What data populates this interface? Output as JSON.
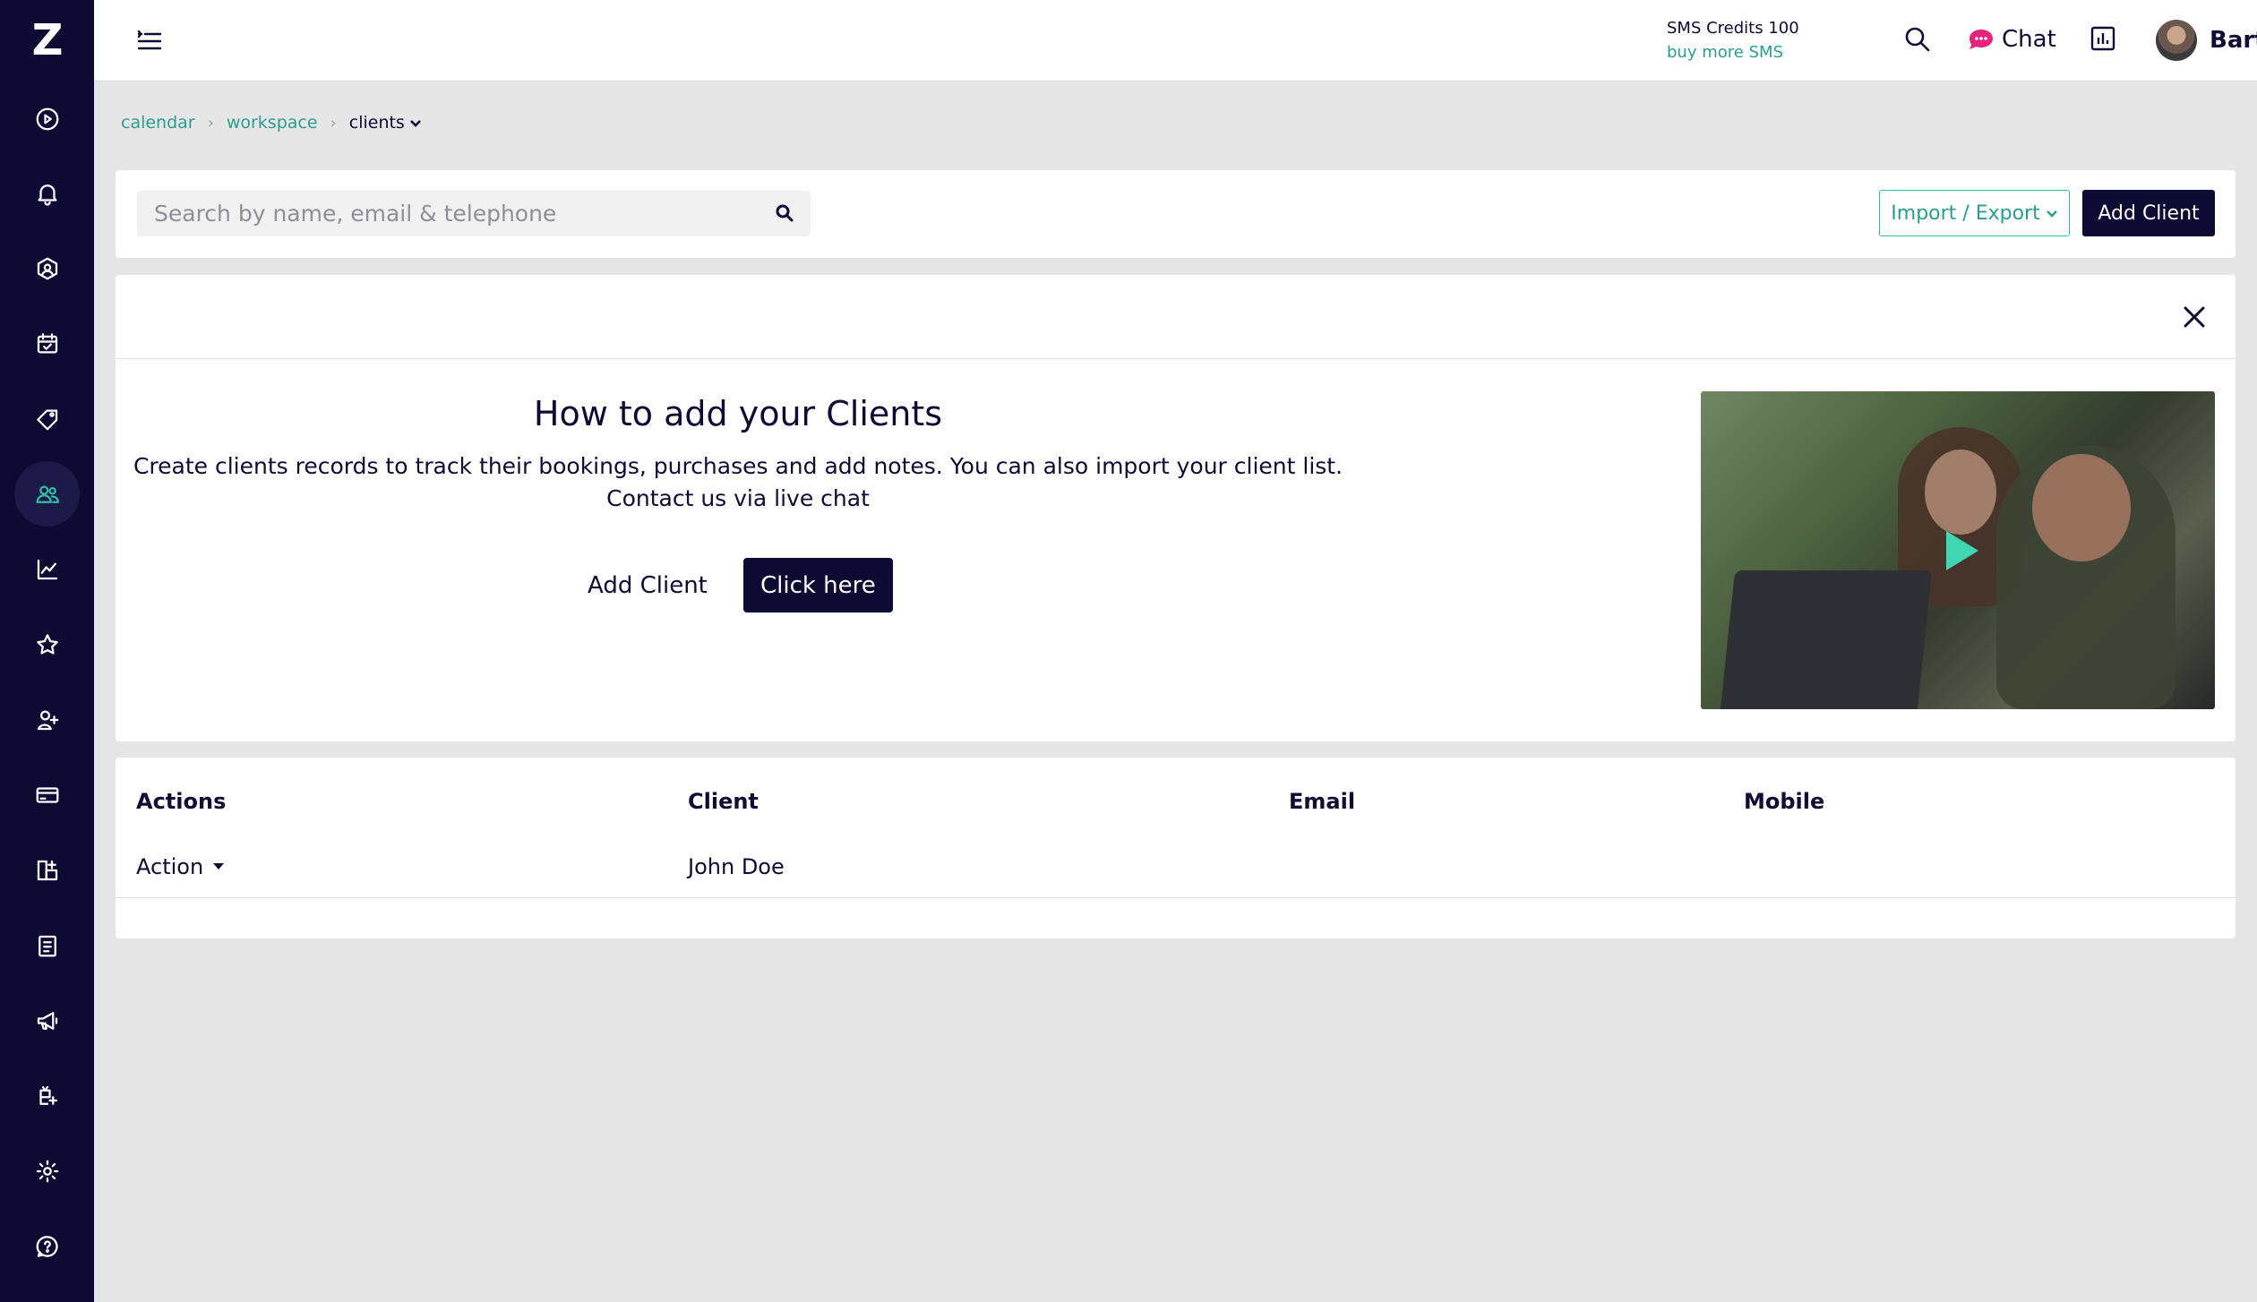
{
  "sidebar": {
    "logo": "Z",
    "items": [
      {
        "name": "play-circle-icon"
      },
      {
        "name": "bell-icon"
      },
      {
        "name": "cube-icon"
      },
      {
        "name": "calendar-check-icon"
      },
      {
        "name": "tag-icon"
      },
      {
        "name": "users-icon",
        "active": true
      },
      {
        "name": "chart-line-icon"
      },
      {
        "name": "star-icon"
      },
      {
        "name": "user-plus-icon"
      },
      {
        "name": "credit-card-icon"
      },
      {
        "name": "apps-add-icon"
      },
      {
        "name": "clipboard-icon"
      },
      {
        "name": "megaphone-icon"
      },
      {
        "name": "gift-icon"
      },
      {
        "name": "gear-icon"
      },
      {
        "name": "help-icon"
      }
    ]
  },
  "topbar": {
    "sms_credits": "SMS Credits 100",
    "buy_more": "buy more SMS",
    "chat_label": "Chat",
    "user_name": "Bartek"
  },
  "breadcrumb": {
    "items": [
      "calendar",
      "workspace"
    ],
    "current": "clients"
  },
  "search": {
    "placeholder": "Search by name, email & telephone",
    "value": ""
  },
  "toolbar": {
    "import_export_label": "Import / Export",
    "add_client_label": "Add Client"
  },
  "info": {
    "title": "How to add your Clients",
    "description_line1": "Create clients records to track their bookings, purchases and add notes. You can also import your client list.",
    "description_line2": "Contact us via live chat",
    "add_client_label": "Add Client",
    "click_here_label": "Click here"
  },
  "table": {
    "columns": [
      "Actions",
      "Client",
      "Email",
      "Mobile"
    ],
    "rows": [
      {
        "action": "Action",
        "client": "John Doe",
        "email": "",
        "mobile": ""
      }
    ]
  },
  "colors": {
    "sidebar_bg": "#0d0b33",
    "accent": "#2fbfa5",
    "link": "#2a9d8f",
    "chat_icon": "#e8237e",
    "page_bg": "#e6e6e6"
  }
}
